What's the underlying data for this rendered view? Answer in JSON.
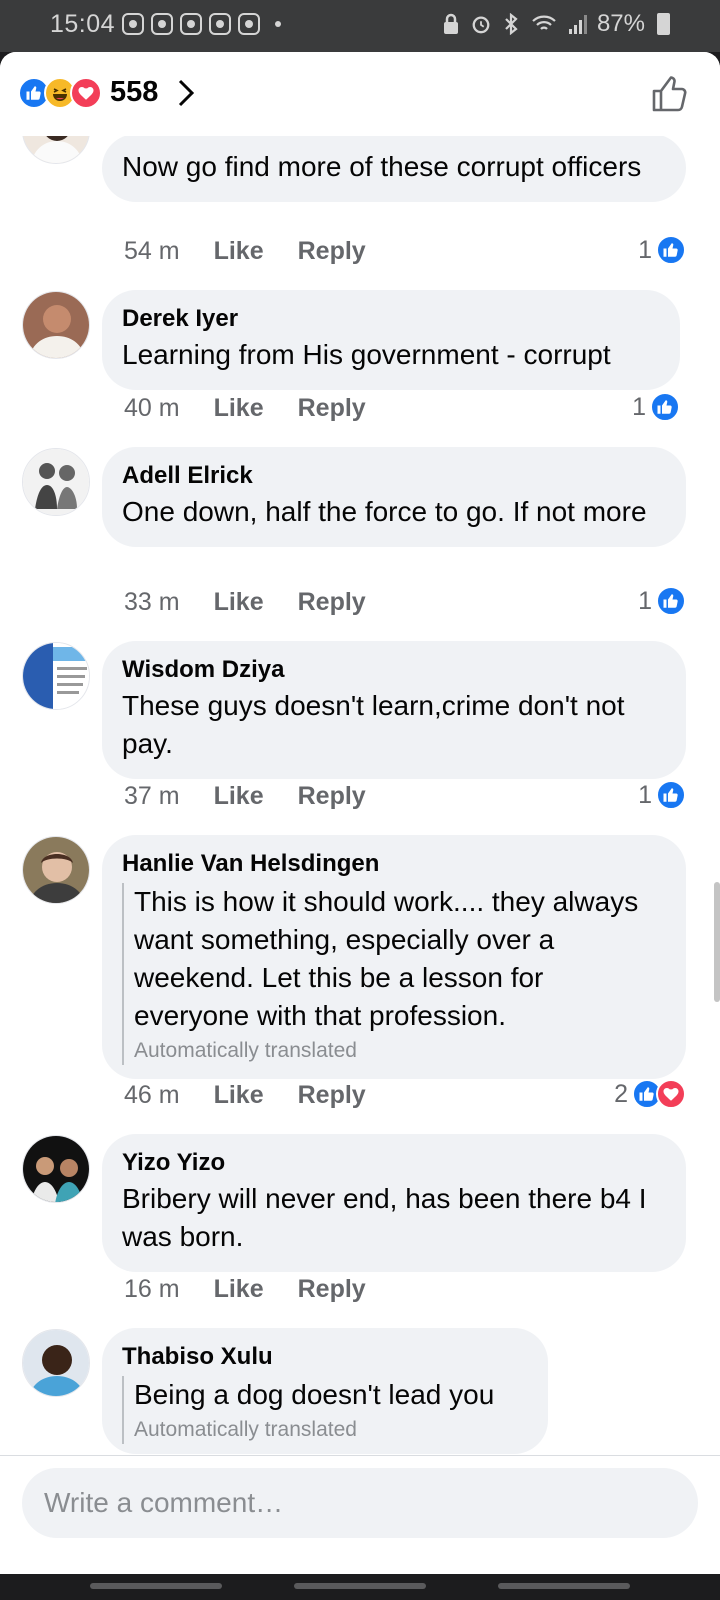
{
  "status_bar": {
    "time": "15:04",
    "battery": "87%"
  },
  "header": {
    "reaction_count": "558",
    "reactions": [
      "like-icon",
      "haha-icon",
      "love-icon"
    ]
  },
  "comments": [
    {
      "author": "",
      "text": "Now go find more of these corrupt officers",
      "time": "54 m",
      "like_label": "Like",
      "reply_label": "Reply",
      "reaction_count": "1",
      "reactions": [
        "like"
      ]
    },
    {
      "author": "Derek Iyer",
      "text": "Learning from His government -  corrupt",
      "time": "40 m",
      "like_label": "Like",
      "reply_label": "Reply",
      "reaction_count": "1",
      "reactions": [
        "like"
      ]
    },
    {
      "author": "Adell Elrick",
      "text": "One down, half the force to go. If not more",
      "time": "33 m",
      "like_label": "Like",
      "reply_label": "Reply",
      "reaction_count": "1",
      "reactions": [
        "like"
      ]
    },
    {
      "author": "Wisdom Dziya",
      "text": "These guys doesn't learn,crime don't not pay.",
      "time": "37 m",
      "like_label": "Like",
      "reply_label": "Reply",
      "reaction_count": "1",
      "reactions": [
        "like"
      ]
    },
    {
      "author": "Hanlie Van Helsdingen",
      "text": "This is how it should work.... they always want something, especially over a weekend. Let this be a lesson for everyone with that profession.",
      "translated_note": "Automatically translated",
      "time": "46 m",
      "like_label": "Like",
      "reply_label": "Reply",
      "reaction_count": "2",
      "reactions": [
        "like",
        "love"
      ]
    },
    {
      "author": "Yizo Yizo",
      "text": "Bribery will never end, has been there b4 I was born.",
      "time": "16 m",
      "like_label": "Like",
      "reply_label": "Reply"
    },
    {
      "author": "Thabiso Xulu",
      "text": "Being a dog doesn't lead you",
      "translated_note": "Automatically translated"
    }
  ],
  "composer": {
    "placeholder": "Write a comment…"
  },
  "colors": {
    "like_blue": "#1877f2",
    "love_red": "#f33e58",
    "haha_yellow": "#f7b928",
    "bubble_gray": "#f0f2f5"
  }
}
